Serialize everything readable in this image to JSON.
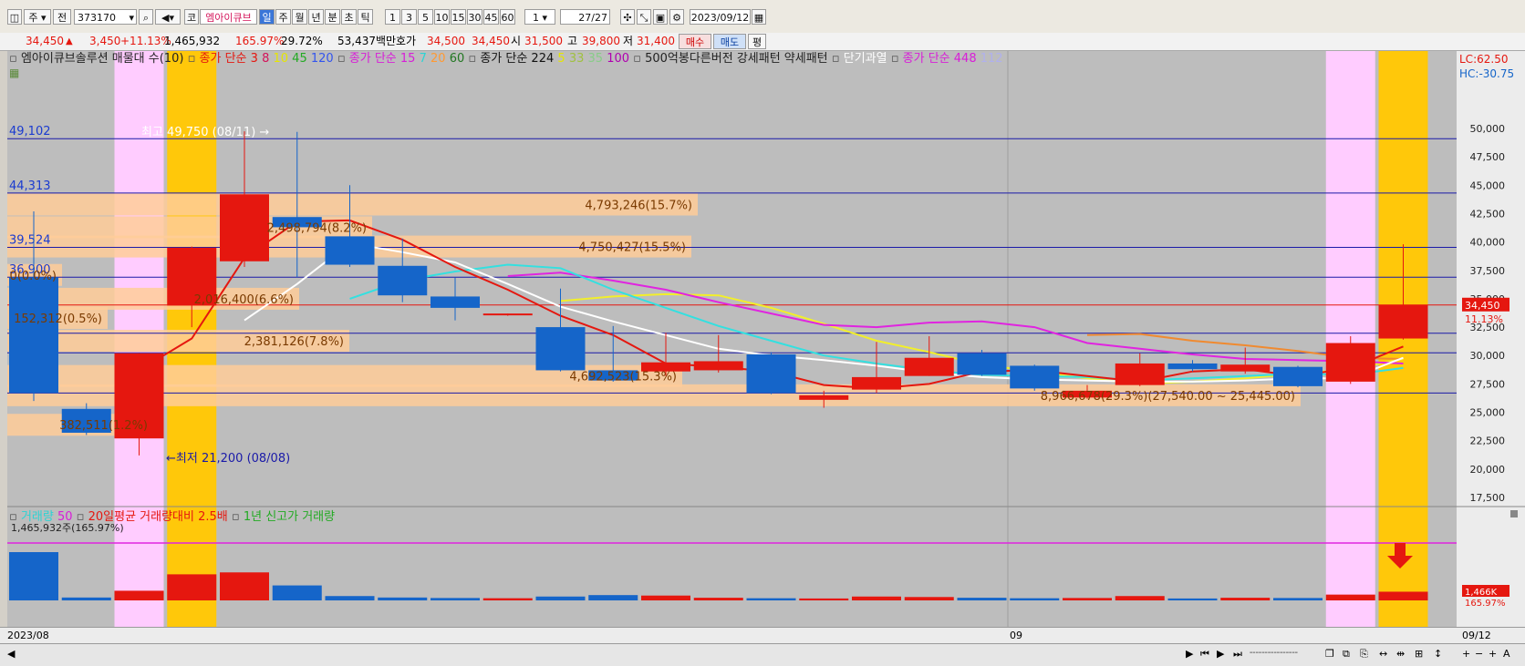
{
  "toolbar": {
    "period_main": "주",
    "prev": "전",
    "code": "373170",
    "market": "코",
    "stock_name": "엠아이큐브",
    "periods": [
      "일",
      "주",
      "월",
      "년",
      "분",
      "초",
      "틱"
    ],
    "selected_period": "일",
    "intervals": [
      "1",
      "3",
      "5",
      "10",
      "15",
      "30",
      "45",
      "60"
    ],
    "count": "1",
    "page": "27",
    "page_total": "/27",
    "date": "2023/09/12"
  },
  "quote": {
    "price": "34,450",
    "up_arrow": "▲",
    "change": "3,450",
    "change_pct": "+11.13%",
    "volume": "1,465,932",
    "vol_ratio": "165.97%",
    "turnover": "29.72%",
    "amount": "53,437백만",
    "bid_label": "호가",
    "bid": "34,500",
    "ask": "34,450",
    "open_label": "시",
    "open": "31,500",
    "high_label": "고",
    "high": "39,800",
    "low_label": "저",
    "low": "31,400",
    "buy_label": "매수",
    "sell_label": "매도",
    "flat_label": "평"
  },
  "legend": {
    "study": "엠아이큐브솔루션 매물대 수(10)",
    "ma1_label": "종가 단순 3",
    "ma1_rest": [
      "8",
      "10",
      "45",
      "120"
    ],
    "ma2_label": "종가 단순 15",
    "ma2_rest": [
      "7",
      "20",
      "60"
    ],
    "ma3_label": "종가 단순 224",
    "ma3_rest": [
      "5",
      "33",
      "35",
      "100"
    ],
    "study2": "500억봉다른버전 강세패턴",
    "study3": "약세패턴",
    "study4": "단기과열",
    "ma4_label": "종가 단순 448",
    "ma4_rest": "112"
  },
  "right_info": {
    "lc": "LC:62.50",
    "hc": "HC:-30.75"
  },
  "price_lines": [
    "49,102",
    "44,313",
    "39,524",
    "36,900",
    "31,968",
    "30,244",
    "26,700"
  ],
  "annotations": {
    "high_note": "최고 49,750 (08/11)",
    "low_note": "최저 21,200 (08/08)"
  },
  "price_badge": {
    "price": "34,450",
    "pct": "11.13%"
  },
  "volume_panel": {
    "legend_vol": "거래량",
    "legend_50": "50",
    "legend_avg": "20일평균 거래량대비 2.5배",
    "legend_year": "1년 신고가 거래량",
    "vol_label": "1,465,932주(165.97%)",
    "badge_vol": "1,466K",
    "badge_pct": "165.97%"
  },
  "x_labels": {
    "start": "2023/08",
    "mid": "09",
    "end": "09/12"
  },
  "colors": {
    "up": "#e5170f",
    "down": "#1565c9",
    "bg": "#bdbdbd",
    "orange_zone": "#ffc80a",
    "pink_zone": "#ffccff",
    "profile": "#ffcc99"
  },
  "chart_data": {
    "type": "candlestick",
    "y_ticks": [
      "50,000",
      "47,500",
      "45,000",
      "42,500",
      "40,000",
      "37,500",
      "35,000",
      "32,500",
      "30,000",
      "27,500",
      "25,000",
      "22,500",
      "20,000",
      "17,500"
    ],
    "candles": [
      {
        "o": 36900,
        "h": 42700,
        "l": 26000,
        "c": 26700
      },
      {
        "o": 25300,
        "h": 25800,
        "l": 23000,
        "c": 23200
      },
      {
        "o": 22700,
        "h": 30200,
        "l": 21200,
        "c": 30200
      },
      {
        "o": 34400,
        "h": 39600,
        "l": 32500,
        "c": 39500
      },
      {
        "o": 38300,
        "h": 49750,
        "l": 37800,
        "c": 44200
      },
      {
        "o": 42200,
        "h": 49700,
        "l": 36900,
        "c": 41300
      },
      {
        "o": 40500,
        "h": 45000,
        "l": 37800,
        "c": 38000
      },
      {
        "o": 37900,
        "h": 40300,
        "l": 34700,
        "c": 35300
      },
      {
        "o": 35200,
        "h": 36900,
        "l": 33100,
        "c": 34200
      },
      {
        "o": 33600,
        "h": 33700,
        "l": 33500,
        "c": 33700
      },
      {
        "o": 32500,
        "h": 35900,
        "l": 28600,
        "c": 28700
      },
      {
        "o": 28700,
        "h": 32600,
        "l": 27700,
        "c": 27800
      },
      {
        "o": 28600,
        "h": 32000,
        "l": 28200,
        "c": 29400
      },
      {
        "o": 28700,
        "h": 31800,
        "l": 28500,
        "c": 29500
      },
      {
        "o": 30100,
        "h": 30300,
        "l": 26600,
        "c": 26700
      },
      {
        "o": 26100,
        "h": 26900,
        "l": 25400,
        "c": 26500
      },
      {
        "o": 27000,
        "h": 31200,
        "l": 26700,
        "c": 28100
      },
      {
        "o": 28200,
        "h": 31700,
        "l": 28200,
        "c": 29800
      },
      {
        "o": 30200,
        "h": 30500,
        "l": 28200,
        "c": 28300
      },
      {
        "o": 29100,
        "h": 29200,
        "l": 26900,
        "c": 27100
      },
      {
        "o": 26300,
        "h": 27400,
        "l": 26200,
        "c": 26900
      },
      {
        "o": 27400,
        "h": 30200,
        "l": 27300,
        "c": 29300
      },
      {
        "o": 29300,
        "h": 29600,
        "l": 28600,
        "c": 28800
      },
      {
        "o": 28600,
        "h": 30700,
        "l": 28400,
        "c": 29200
      },
      {
        "o": 29000,
        "h": 29100,
        "l": 27200,
        "c": 27300
      },
      {
        "o": 27700,
        "h": 31700,
        "l": 27500,
        "c": 31100
      },
      {
        "o": 31500,
        "h": 39800,
        "l": 31400,
        "c": 34450
      }
    ],
    "volumes": [
      1000,
      60,
      200,
      540,
      580,
      310,
      90,
      60,
      50,
      45,
      80,
      110,
      100,
      55,
      45,
      40,
      80,
      70,
      55,
      45,
      50,
      90,
      40,
      55,
      50,
      120,
      180
    ],
    "ma_red": [
      null,
      null,
      28700,
      31500,
      38600,
      41800,
      41900,
      40200,
      37800,
      35800,
      33500,
      31800,
      29300,
      29000,
      28600,
      27400,
      27100,
      27500,
      28600,
      28700,
      28200,
      27700,
      28600,
      28800,
      28200,
      28900,
      30800
    ],
    "ma_white": [
      null,
      null,
      null,
      null,
      33100,
      36300,
      39900,
      39100,
      38200,
      36300,
      34300,
      33000,
      31800,
      30600,
      30000,
      29600,
      29100,
      28500,
      28100,
      27900,
      27800,
      27700,
      27700,
      27800,
      28000,
      28000,
      29800
    ],
    "ma_cyan": [
      null,
      null,
      null,
      null,
      null,
      null,
      35000,
      36600,
      37400,
      38000,
      37700,
      35800,
      34200,
      32600,
      31300,
      30000,
      29300,
      28700,
      28300,
      28200,
      28100,
      27800,
      28000,
      28200,
      28400,
      28300,
      28900
    ],
    "ma_magenta": [
      null,
      null,
      null,
      null,
      null,
      null,
      null,
      null,
      null,
      37000,
      37300,
      36600,
      35800,
      34700,
      33700,
      32700,
      32500,
      32900,
      33000,
      32500,
      31100,
      30600,
      30100,
      29700,
      29600,
      29500,
      29300
    ],
    "ma_yellow": [
      null,
      null,
      null,
      null,
      null,
      null,
      null,
      null,
      null,
      null,
      34800,
      35200,
      35400,
      35300,
      34200,
      32800,
      31300,
      30300,
      29200,
      28600,
      28000,
      27500,
      27700,
      28000,
      28400,
      28800,
      29700
    ],
    "ma_orange": [
      null,
      null,
      null,
      null,
      null,
      null,
      null,
      null,
      null,
      null,
      null,
      null,
      null,
      null,
      null,
      null,
      null,
      null,
      null,
      null,
      31800,
      31900,
      31300,
      30900,
      30400,
      29800,
      29700
    ],
    "volume_profile": [
      {
        "label": "382,511(1.2%)",
        "price": 23900,
        "width": 160
      },
      {
        "label": "2,381,126(7.8%)",
        "price": 31300,
        "width": 375
      },
      {
        "label": "2,016,400(6.6%)",
        "price": 35000,
        "width": 320
      },
      {
        "label": "4,750,427(15.5%)",
        "price": 39600,
        "width": 750
      },
      {
        "label": "4,793,246(15.7%)",
        "price": 43300,
        "width": 757
      },
      {
        "label": "2,498,794(8.2%)",
        "price": 41300,
        "width": 400
      },
      {
        "label": "4,692,523(15.3%)",
        "price": 28200,
        "width": 740
      },
      {
        "label": "8,966,678(29.3%)(27,540.00 ~ 25,445.00)",
        "price": 26500,
        "width": 1418
      },
      {
        "label": "152,312(0.5%)",
        "price": 33300,
        "width": 110
      },
      {
        "label": "0(0.0%)",
        "price": 37100,
        "width": 60
      }
    ],
    "zones_pink": [
      2,
      25
    ],
    "zones_orange": [
      3,
      26
    ]
  }
}
